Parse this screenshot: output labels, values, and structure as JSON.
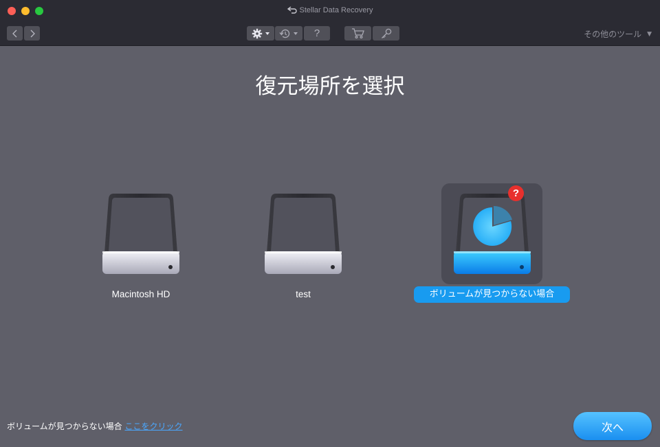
{
  "window": {
    "title": "Stellar Data Recovery"
  },
  "toolbar": {
    "help_label": "?",
    "other_tools_label": "その他のツール",
    "other_tools_caret": "▼"
  },
  "main": {
    "heading": "復元場所を選択",
    "drives": [
      {
        "label": "Macintosh HD",
        "selected": false
      },
      {
        "label": "test",
        "selected": false
      },
      {
        "label": "ボリュームが見つからない場合",
        "selected": true
      }
    ],
    "unknown_badge": "?"
  },
  "footer": {
    "hint_text": "ボリュームが見つからない場合",
    "hint_link": "ここをクリック",
    "next_label": "次へ"
  },
  "colors": {
    "background": "#5f5f69",
    "titlebar": "#2b2b33",
    "accent": "#189bf0",
    "link": "#4aa8ff"
  },
  "icons": {
    "back": "chevron-left-icon",
    "forward": "chevron-right-icon",
    "settings": "gear-icon",
    "history": "history-icon",
    "cart": "cart-icon",
    "key": "key-icon",
    "app": "app-logo-icon"
  }
}
